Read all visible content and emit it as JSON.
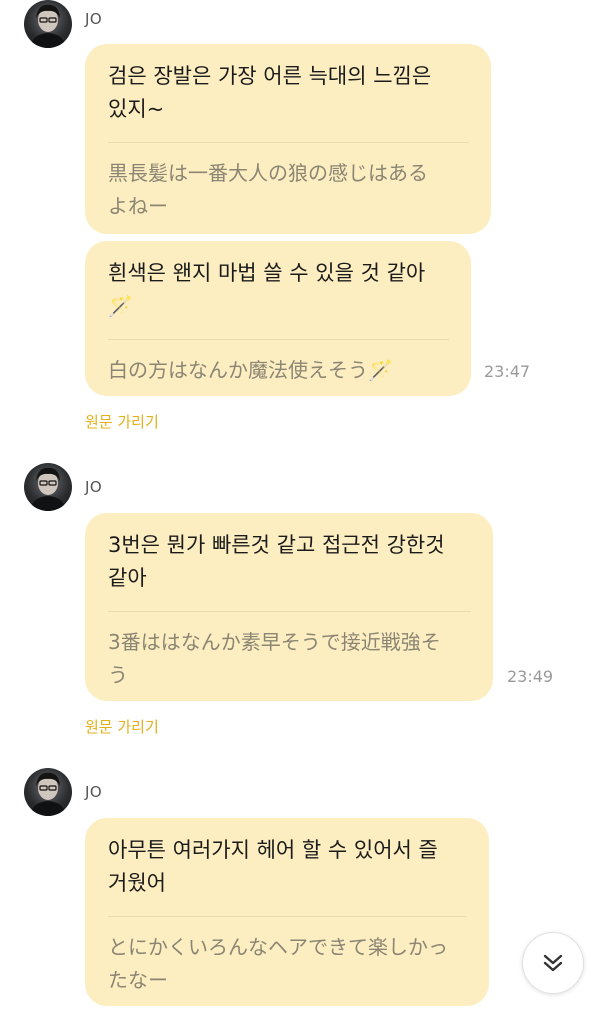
{
  "messages": [
    {
      "sender": "JO",
      "original": "검은 장발은 가장 어른 늑대의 느낌은\n있지~",
      "translation": "黒長髪は一番大人の狼の感じはある\nよねー"
    },
    {
      "original_text": "흰색은 왠지 마법 쓸 수 있을 것 같아",
      "original_emoji": "🪄",
      "translation_text": "白の方はなんか魔法使えそう",
      "translation_emoji": "🪄",
      "time": "23:47",
      "hide_label": "원문 가리기"
    },
    {
      "sender": "JO",
      "original": "3번은 뭔가 빠른것 같고 접근전 강한것\n같아",
      "translation": "3番ははなんか素早そうで接近戦強そ\nう",
      "time": "23:49",
      "hide_label": "원문 가리기"
    },
    {
      "sender": "JO",
      "original": "아무튼 여러가지 헤어 할 수 있어서 즐\n거웠어",
      "translation": "とにかくいろんなヘアできて楽しかっ\nたなー"
    }
  ],
  "icons": {
    "avatar": "profile-photo-icon",
    "scroll_down": "double-chevron-down-icon"
  },
  "colors": {
    "bubble": "#fdeec2",
    "hide_link": "#e3b018"
  }
}
